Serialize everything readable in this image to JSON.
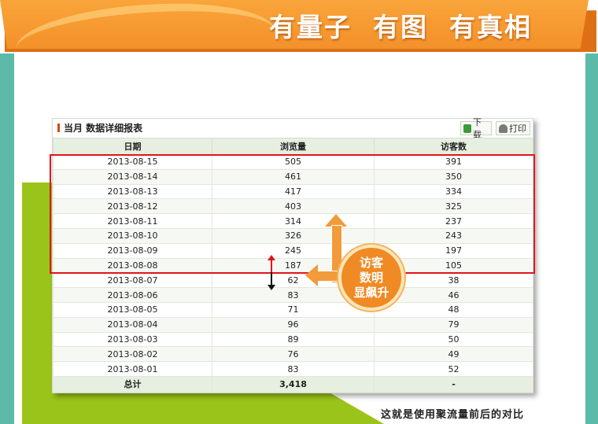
{
  "banner": {
    "title": "有量子  有图  有真相"
  },
  "report": {
    "title": "当月 数据详细报表",
    "download_label": "下载",
    "print_label": "打印",
    "columns": [
      "日期",
      "浏览量",
      "访客数"
    ],
    "rows": [
      [
        "2013-08-15",
        "505",
        "391"
      ],
      [
        "2013-08-14",
        "461",
        "350"
      ],
      [
        "2013-08-13",
        "417",
        "334"
      ],
      [
        "2013-08-12",
        "403",
        "325"
      ],
      [
        "2013-08-11",
        "314",
        "237"
      ],
      [
        "2013-08-10",
        "326",
        "243"
      ],
      [
        "2013-08-09",
        "245",
        "197"
      ],
      [
        "2013-08-08",
        "187",
        "105"
      ],
      [
        "2013-08-07",
        "62",
        "38"
      ],
      [
        "2013-08-06",
        "83",
        "46"
      ],
      [
        "2013-08-05",
        "71",
        "48"
      ],
      [
        "2013-08-04",
        "96",
        "79"
      ],
      [
        "2013-08-03",
        "89",
        "50"
      ],
      [
        "2013-08-02",
        "76",
        "49"
      ],
      [
        "2013-08-01",
        "83",
        "52"
      ]
    ],
    "total": [
      "总计",
      "3,418",
      "-"
    ]
  },
  "annotation": {
    "badge_lines": [
      "访客",
      "数明",
      "显飙升"
    ]
  },
  "caption": "这就是使用聚流量前后的对比",
  "colors": {
    "banner": "#f4902a",
    "highlight": "#e2141b",
    "teal": "#5cbaa9",
    "green": "#9bc41a"
  }
}
